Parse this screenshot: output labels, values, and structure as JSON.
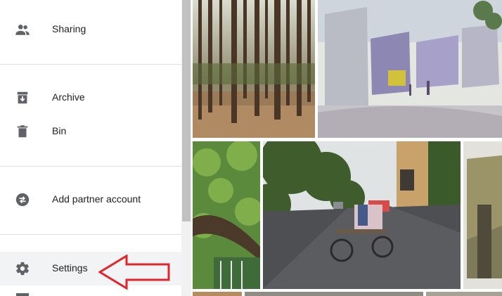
{
  "sidebar": {
    "items": [
      {
        "label": "Sharing",
        "icon": "people-icon"
      },
      {
        "label": "Archive",
        "icon": "archive-icon"
      },
      {
        "label": "Bin",
        "icon": "bin-icon"
      },
      {
        "label": "Add partner account",
        "icon": "partner-swap-icon"
      },
      {
        "label": "Settings",
        "icon": "gear-icon"
      }
    ]
  },
  "photos": [
    {
      "subject": "forest-trees"
    },
    {
      "subject": "watercolor-street"
    },
    {
      "subject": "tree-branch"
    },
    {
      "subject": "street-rickshaw"
    },
    {
      "subject": "painting-partial"
    }
  ],
  "colors": {
    "icon": "#5f6368",
    "text": "#202124",
    "arrow": "#e0262c",
    "active_bg": "#f1f3f4"
  }
}
